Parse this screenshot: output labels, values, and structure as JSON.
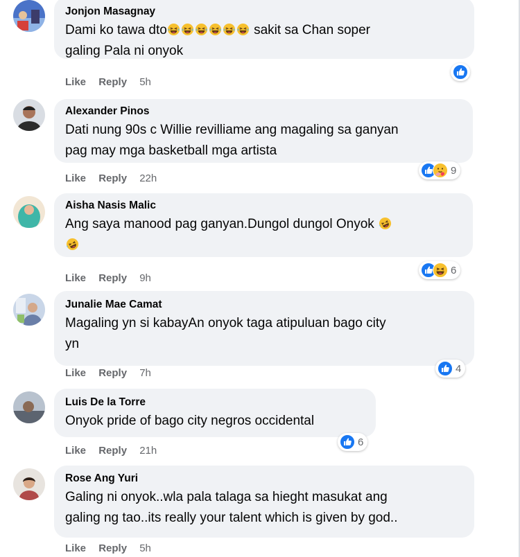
{
  "comments": [
    {
      "author": "Jonjon Masagnay",
      "line1_pre": "Dami ko tawa dto",
      "line1_post": " sakit sa Chan soper",
      "line2": "galing Pala ni onyok",
      "like": "Like",
      "reply": "Reply",
      "time": "5h",
      "reaction_count": ""
    },
    {
      "author": "Alexander Pinos",
      "line1": "Dati nung 90s c Willie revilliame ang magaling sa ganyan",
      "line2": "pag may mga basketball mga artista",
      "like": "Like",
      "reply": "Reply",
      "time": "22h",
      "reaction_count": "9"
    },
    {
      "author": "Aisha Nasis Malic",
      "line1": "Ang saya manood pag ganyan.Dungol dungol Onyok ",
      "like": "Like",
      "reply": "Reply",
      "time": "9h",
      "reaction_count": "6"
    },
    {
      "author": "Junalie Mae Camat",
      "line1": "Magaling yn si kabayAn onyok taga atipuluan bago city",
      "line2": "yn",
      "like": "Like",
      "reply": "Reply",
      "time": "7h",
      "reaction_count": "4"
    },
    {
      "author": "Luis De la Torre",
      "line1": "Onyok pride of bago city negros occidental",
      "like": "Like",
      "reply": "Reply",
      "time": "21h",
      "reaction_count": "6"
    },
    {
      "author": "Rose Ang Yuri",
      "line1": "Galing ni onyok..wla pala talaga sa hieght masukat ang",
      "line2": "galing ng tao..its really your talent which is given by god..",
      "like": "Like",
      "reply": "Reply",
      "time": "5h",
      "reaction_count": ""
    }
  ],
  "colors": {
    "bubble": "#f0f2f5",
    "meta": "#65676b",
    "like_blue": "#1877f2"
  },
  "icons": {
    "like": "like-reaction-icon",
    "haha": "haha-reaction-icon",
    "care": "care-reaction-icon"
  }
}
